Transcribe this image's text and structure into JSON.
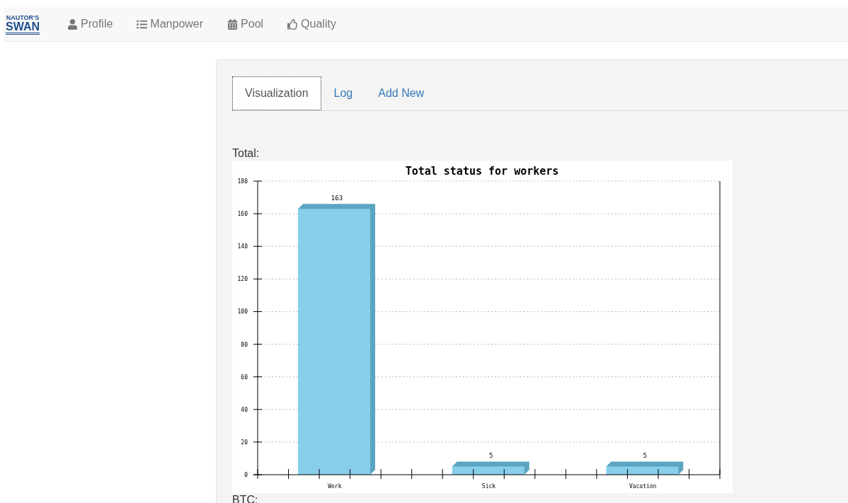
{
  "navbar": {
    "logo": {
      "line1": "NAUTOR'S",
      "line2": "SWAN"
    },
    "items": [
      {
        "label": "Profile"
      },
      {
        "label": "Manpower"
      },
      {
        "label": "Pool"
      },
      {
        "label": "Quality"
      }
    ]
  },
  "tabs": [
    {
      "label": "Visualization",
      "selected": true
    },
    {
      "label": "Log",
      "selected": false
    },
    {
      "label": "Add New",
      "selected": false
    }
  ],
  "sections": [
    {
      "label": "Total:",
      "chart_data": {
        "type": "bar",
        "title": "Total status for workers",
        "categories": [
          "Work",
          "Sick",
          "Vacation"
        ],
        "series": [
          {
            "color": "#87ceeb",
            "values": [
              163,
              5,
              5
            ]
          }
        ],
        "grid": true,
        "ylim": [
          0,
          180
        ],
        "yticks": [
          0,
          20,
          40,
          60,
          80,
          100,
          120,
          140,
          160,
          180
        ],
        "data_labels": true
      }
    },
    {
      "label": "BTC:"
    }
  ]
}
